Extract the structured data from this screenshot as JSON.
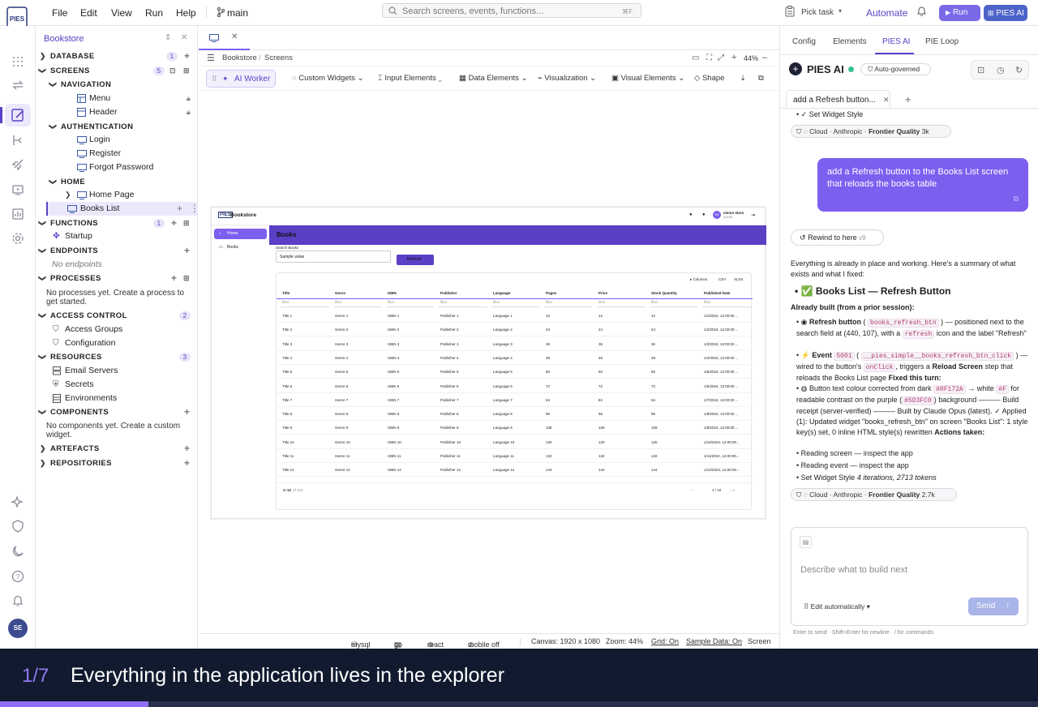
{
  "app": {
    "logo_text": "PIES",
    "branch": "main",
    "accent": "#5b3fc5"
  },
  "menu": [
    "File",
    "Edit",
    "View",
    "Run",
    "Help"
  ],
  "search": {
    "placeholder": "Search screens, events, functions...",
    "shortcut": "⌘F"
  },
  "header_right": {
    "pick_task": "Pick task",
    "automate": "Automate",
    "run": "Run",
    "pies_ai": "PIES AI"
  },
  "explorer": {
    "title": "Bookstore",
    "sections": {
      "database": {
        "label": "DATABASE",
        "count": "1"
      },
      "screens": {
        "label": "SCREENS",
        "count": "5"
      },
      "navigation": "NAVIGATION",
      "menu": "Menu",
      "header": "Header",
      "authentication": "AUTHENTICATION",
      "login": "Login",
      "register": "Register",
      "forgot": "Forgot Password",
      "home": "HOME",
      "home_page": "Home Page",
      "books_list": "Books List",
      "functions": {
        "label": "FUNCTIONS",
        "count": "1"
      },
      "startup": "Startup",
      "endpoints": "ENDPOINTS",
      "no_endpoints": "No endpoints",
      "processes": "PROCESSES",
      "no_processes": "No processes yet. Create a process to get started.",
      "access_control": {
        "label": "ACCESS CONTROL",
        "count": "2"
      },
      "access_groups": "Access Groups",
      "configuration": "Configuration",
      "resources": {
        "label": "RESOURCES",
        "count": "3"
      },
      "email_servers": "Email Servers",
      "secrets": "Secrets",
      "environments": "Environments",
      "components": "COMPONENTS",
      "no_components": "No components yet. Create a custom widget.",
      "artefacts": "ARTEFACTS",
      "repositories": "REPOSITORIES"
    }
  },
  "editor": {
    "breadcrumb": [
      "Bookstore",
      "Screens"
    ],
    "zoom": "44%",
    "toolbar": {
      "ai_worker": "AI Worker",
      "custom_widgets": "Custom Widgets",
      "input_elements": "Input Elements",
      "data_elements": "Data Elements",
      "visualization": "Visualization",
      "visual_elements": "Visual Elements",
      "shape": "Shape"
    }
  },
  "preview": {
    "app_name": "Bookstore",
    "user": "simon elaro",
    "user_sub": "ADMIN",
    "avatar": "SE",
    "nav": [
      "Home",
      "Books"
    ],
    "page_title": "Books",
    "search_label": "Search Books",
    "search_value": "Sample value",
    "refresh": "Refresh",
    "table_tools": [
      "Columns",
      "CSV",
      "XLSX"
    ],
    "columns": [
      "Title",
      "Genre",
      "ISBN",
      "Publisher",
      "Language",
      "Pages",
      "Price",
      "Stock Quantity",
      "Published Date"
    ],
    "filter": "filter",
    "rows": [
      [
        "Title 1",
        "Genre 1",
        "ISBN 1",
        "Publisher 1",
        "Language 1",
        "12",
        "12",
        "12",
        "1/1/2024, 12:00:00 ..."
      ],
      [
        "Title 2",
        "Genre 2",
        "ISBN 2",
        "Publisher 2",
        "Language 2",
        "24",
        "24",
        "24",
        "1/2/2024, 12:00:00 ..."
      ],
      [
        "Title 3",
        "Genre 3",
        "ISBN 3",
        "Publisher 3",
        "Language 3",
        "36",
        "36",
        "36",
        "1/3/2024, 12:00:00 ..."
      ],
      [
        "Title 4",
        "Genre 4",
        "ISBN 4",
        "Publisher 4",
        "Language 4",
        "48",
        "48",
        "48",
        "1/4/2024, 12:00:00 ..."
      ],
      [
        "Title 5",
        "Genre 5",
        "ISBN 5",
        "Publisher 5",
        "Language 5",
        "60",
        "60",
        "60",
        "1/5/2024, 12:00:00 ..."
      ],
      [
        "Title 6",
        "Genre 6",
        "ISBN 6",
        "Publisher 6",
        "Language 6",
        "72",
        "72",
        "72",
        "1/6/2024, 12:00:00 ..."
      ],
      [
        "Title 7",
        "Genre 7",
        "ISBN 7",
        "Publisher 7",
        "Language 7",
        "84",
        "84",
        "84",
        "1/7/2024, 12:00:00 ..."
      ],
      [
        "Title 8",
        "Genre 8",
        "ISBN 8",
        "Publisher 8",
        "Language 8",
        "96",
        "96",
        "96",
        "1/8/2024, 12:00:00 ..."
      ],
      [
        "Title 9",
        "Genre 9",
        "ISBN 9",
        "Publisher 9",
        "Language 9",
        "108",
        "108",
        "108",
        "1/9/2024, 12:00:00 ..."
      ],
      [
        "Title 10",
        "Genre 10",
        "ISBN 10",
        "Publisher 10",
        "Language 10",
        "120",
        "120",
        "120",
        "1/10/2024, 12:00:00..."
      ],
      [
        "Title 11",
        "Genre 11",
        "ISBN 11",
        "Publisher 11",
        "Language 11",
        "132",
        "132",
        "132",
        "1/11/2024, 12:00:00..."
      ],
      [
        "Title 12",
        "Genre 12",
        "ISBN 12",
        "Publisher 12",
        "Language 12",
        "144",
        "144",
        "144",
        "1/12/2024, 12:00:00..."
      ]
    ],
    "range": "1–12",
    "of": "of 120",
    "page": "1 / 10"
  },
  "status": {
    "db": "mysql",
    "lang": "go",
    "ui": "react",
    "mobile": "mobile off",
    "canvas": "Canvas: 1920 x 1080",
    "zoom": "Zoom: 44%",
    "grid": "Grid: On",
    "sample": "Sample Data: On",
    "mode": "Screen"
  },
  "right_panel": {
    "tabs": [
      "Config",
      "Elements",
      "PIES AI",
      "PIE Loop"
    ],
    "title": "PIES AI",
    "governed": "Auto-governed",
    "chat_tab": "add a Refresh button...",
    "set_widget_style": "✓ Set Widget Style",
    "pill1": {
      "provider": "Cloud",
      "vendor": "Anthropic",
      "quality": "Frontier Quality",
      "tokens": "3k"
    },
    "user_message": "add a Refresh button to the Books List screen that reloads the books table",
    "rewind": "Rewind to here",
    "rewind_ver": "v9",
    "intro": "Everything is already in place and working. Here's a summary of what exists and what I fixed:",
    "heading": "✅ Books List — Refresh Button",
    "already_built": "Already built (from a prior session):",
    "b1_label": "Refresh button",
    "b1_code": "books_refresh_btn",
    "b1_text": "— positioned next to the search field at (440, 107), with a",
    "b1_code2": "refresh",
    "b1_text2": "icon and the label \"Refresh\"",
    "b2_label": "Event",
    "b2_code": "5001",
    "b2_code2": "__pies_simple__books_refresh_btn_click",
    "b2_text": "— wired to the button's",
    "b2_code3": "onClick",
    "b2_text2": ", triggers a",
    "b2_bold": "Reload Screen",
    "b2_text3": "step that reloads the Books List page",
    "fixed": "Fixed this turn:",
    "b3_text": "Button text colour corrected from dark",
    "b3_code": "#0F172A",
    "b3_text2": "→ white",
    "b3_code2": "#F",
    "b3_text3": "for readable contrast on the purple (",
    "b3_code3": "#5D3FC0",
    "b3_text4": ") background ——— Build receipt (server-verified) ——— Built by Claude Opus (latest). ✓ Applied (1): Updated widget \"books_refresh_btn\" on screen \"Books List\": 1 style key(s) set, 0 inline HTML style(s) rewritten",
    "actions_taken": "Actions taken:",
    "a1": "Reading screen — inspect the app",
    "a2": "Reading event — inspect the app",
    "a3": "Set Widget Style",
    "a3_meta": "4 iterations, 2713 tokens",
    "pill2": {
      "provider": "Cloud",
      "vendor": "Anthropic",
      "quality": "Frontier Quality",
      "tokens": "2.7k"
    },
    "input_placeholder": "Describe what to build next",
    "edit_mode": "Edit automatically",
    "send": "Send",
    "hint": "Enter to send · Shift+Enter for newline · / for commands"
  },
  "caption": {
    "step": "1/7",
    "text": "Everything in the application lives in the explorer",
    "progress": 0.1429
  }
}
